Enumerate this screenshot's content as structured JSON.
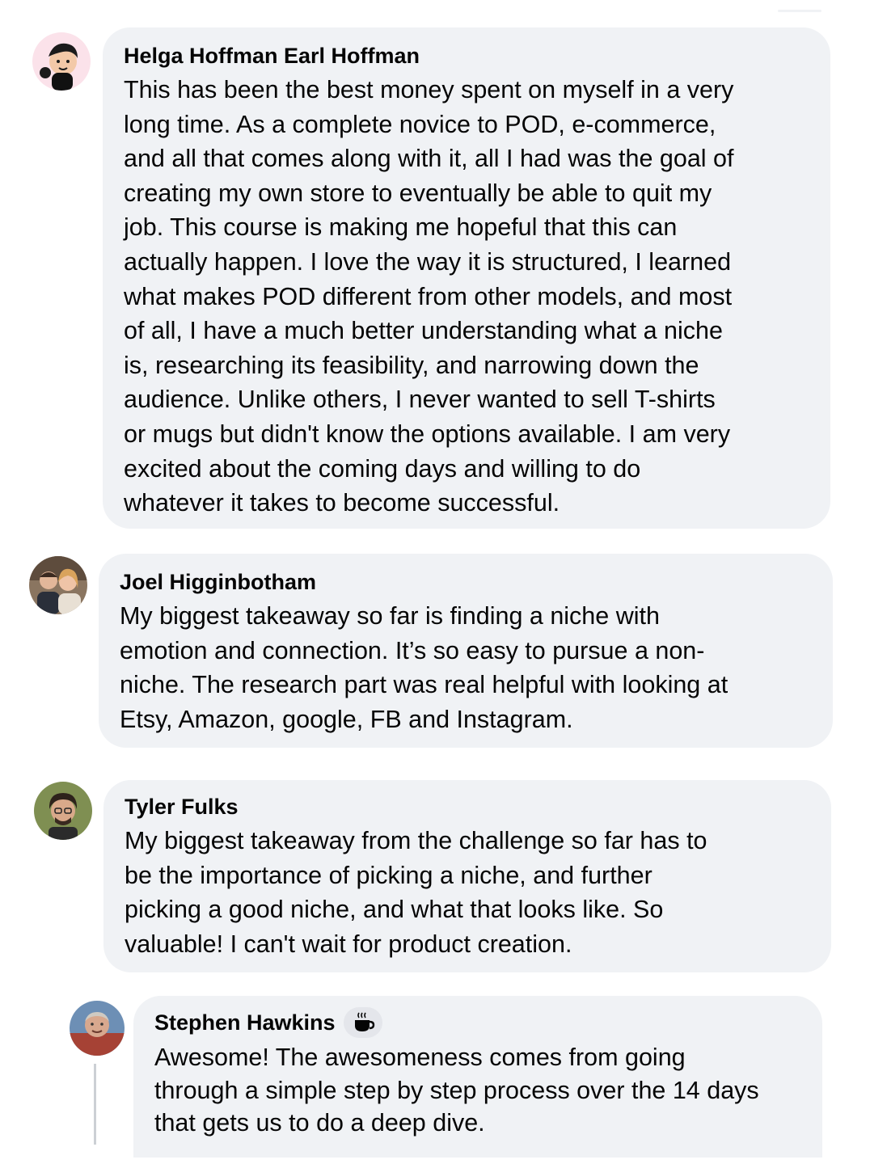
{
  "comments": [
    {
      "author": "Helga Hoffman Earl Hoffman",
      "text": "This has been the best money spent on myself in a very\nlong time. As a complete novice to POD, e-commerce,\nand all that comes along with it, all I had was the goal of\ncreating my own store to eventually be able to quit my\njob. This course is making me hopeful that this can\nactually happen. I love the way it is structured, I learned\nwhat makes POD different from other models, and most\nof all, I have a much better understanding what a niche\nis, researching its feasibility, and narrowing down the\naudience. Unlike others, I never wanted to sell T-shirts\nor mugs but didn't know the options available. I am very\nexcited about the coming days and willing to do\nwhatever it takes to become successful."
    },
    {
      "author": "Joel Higginbotham",
      "text": "My biggest takeaway so far is finding a niche with\nemotion and connection. It’s so easy to pursue a non-\nniche. The research part was real helpful with looking at\nEtsy, Amazon, google, FB and Instagram."
    },
    {
      "author": "Tyler Fulks",
      "text": "My biggest takeaway from the challenge so far has to\nbe the importance of picking a niche, and further\npicking a good niche, and what that looks like. So\nvaluable! I can't wait for product creation."
    },
    {
      "author": "Stephen Hawkins",
      "badge_icon": "coffee-cup-icon",
      "text": "Awesome! The awesomeness comes from going\nthrough a simple step by step process over the 14 days\nthat gets us to do a deep dive."
    }
  ],
  "colors": {
    "bubble": "#f0f2f5",
    "text": "#050505",
    "badge": "#e4e6eb"
  }
}
